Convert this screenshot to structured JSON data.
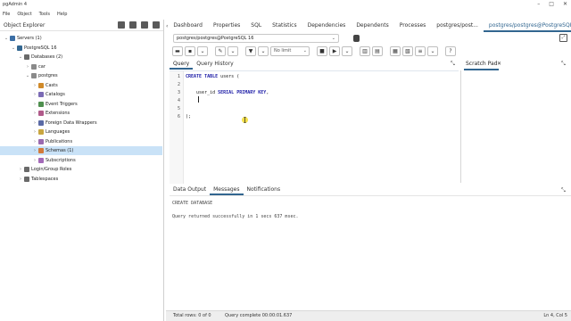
{
  "window": {
    "title": "pgAdmin 4",
    "controls": [
      "–",
      "□",
      "✕"
    ]
  },
  "menu": [
    "File",
    "Object",
    "Tools",
    "Help"
  ],
  "explorer": {
    "title": "Object Explorer",
    "tree": [
      {
        "label": "Servers (1)",
        "indent": 0,
        "icon_color": "#3b6ea5",
        "chevron": "⌄"
      },
      {
        "label": "PostgreSQL 16",
        "indent": 1,
        "icon_color": "#336791",
        "chevron": "⌄"
      },
      {
        "label": "Databases (2)",
        "indent": 2,
        "icon_color": "#6a6a6a",
        "chevron": "⌄"
      },
      {
        "label": "car",
        "indent": 3,
        "icon_color": "#8a8a8a",
        "chevron": "›"
      },
      {
        "label": "postgres",
        "indent": 3,
        "icon_color": "#8a8a8a",
        "chevron": "⌄"
      },
      {
        "label": "Casts",
        "indent": 4,
        "icon_color": "#d08a2a",
        "chevron": "›"
      },
      {
        "label": "Catalogs",
        "indent": 4,
        "icon_color": "#7b6bb5",
        "chevron": "›"
      },
      {
        "label": "Event Triggers",
        "indent": 4,
        "icon_color": "#4f8f4f",
        "chevron": "›"
      },
      {
        "label": "Extensions",
        "indent": 4,
        "icon_color": "#b05a8a",
        "chevron": "›"
      },
      {
        "label": "Foreign Data Wrappers",
        "indent": 4,
        "icon_color": "#5a6aa5",
        "chevron": "›"
      },
      {
        "label": "Languages",
        "indent": 4,
        "icon_color": "#c9a640",
        "chevron": "›"
      },
      {
        "label": "Publications",
        "indent": 4,
        "icon_color": "#9a6ab0",
        "chevron": "›"
      },
      {
        "label": "Schemas (1)",
        "indent": 4,
        "icon_color": "#d27a3a",
        "chevron": "›",
        "selected": true
      },
      {
        "label": "Subscriptions",
        "indent": 4,
        "icon_color": "#a36ab8",
        "chevron": "›"
      },
      {
        "label": "Login/Group Roles",
        "indent": 2,
        "icon_color": "#6a6a6a",
        "chevron": "›"
      },
      {
        "label": "Tablespaces",
        "indent": 2,
        "icon_color": "#6a6a6a",
        "chevron": "›"
      }
    ]
  },
  "tabs": [
    "Dashboard",
    "Properties",
    "SQL",
    "Statistics",
    "Dependencies",
    "Dependents",
    "Processes",
    "postgres/post...",
    "postgres/postgres@PostgreSQL 16*"
  ],
  "active_tab_index": 8,
  "connection": "postgres/postgres@PostgreSQL 16",
  "toolbar": {
    "limit": "No limit"
  },
  "query_tabs": [
    "Query",
    "Query History"
  ],
  "scratch_pad": {
    "title": "Scratch Pad",
    "close": "✕"
  },
  "editor": {
    "lines": [
      {
        "num": "1",
        "segments": [
          {
            "t": "CREATE TABLE",
            "kw": true
          },
          {
            "t": " users (",
            "kw": false
          }
        ]
      },
      {
        "num": "2",
        "segments": []
      },
      {
        "num": "3",
        "segments": [
          {
            "t": "    user_id ",
            "kw": false
          },
          {
            "t": "SERIAL PRIMARY KEY",
            "kw": true
          },
          {
            "t": ",",
            "kw": false
          }
        ]
      },
      {
        "num": "4",
        "segments": []
      },
      {
        "num": "5",
        "segments": []
      },
      {
        "num": "6",
        "segments": [
          {
            "t": ");",
            "kw": false
          }
        ]
      }
    ]
  },
  "output_tabs": [
    "Data Output",
    "Messages",
    "Notifications"
  ],
  "active_output_tab": 1,
  "messages": [
    "CREATE DATABASE",
    "Query returned successfully in 1 secs 637 msec."
  ],
  "status": {
    "total_rows": "Total rows: 0 of 0",
    "query_complete": "Query complete 00:00:01.637",
    "position": "Ln 4, Col 5"
  },
  "colors": {
    "accent": "#326690",
    "selected_row": "#c9e2f7"
  }
}
